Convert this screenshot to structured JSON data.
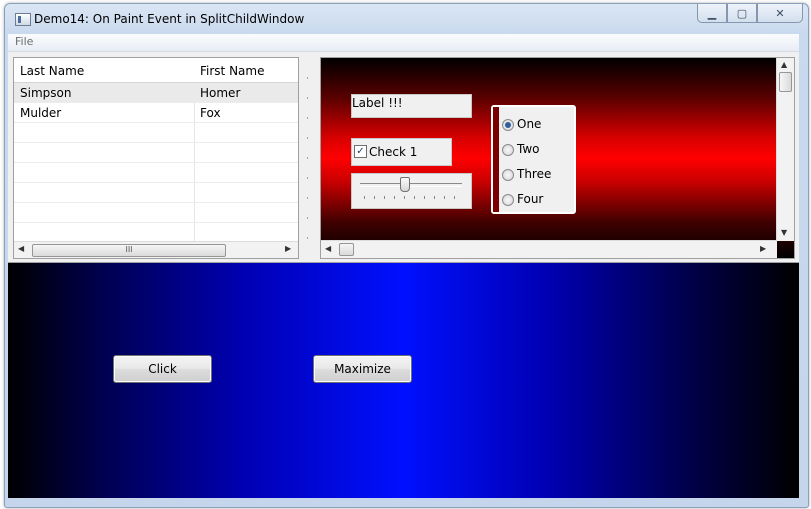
{
  "window": {
    "title": "Demo14: On Paint Event in SplitChildWindow",
    "caption_buttons": [
      "minimize-icon",
      "maximize-icon",
      "close-icon"
    ],
    "caption_glyphs": {
      "minimize": "▁",
      "maximize": "▢",
      "close": "✕"
    }
  },
  "menu": {
    "items": [
      {
        "label": "File"
      }
    ]
  },
  "table": {
    "columns": [
      "Last Name",
      "First Name"
    ],
    "rows": [
      {
        "last": "Simpson",
        "first": "Homer",
        "selected": true
      },
      {
        "last": "Mulder",
        "first": "Fox",
        "selected": false
      }
    ],
    "scroll_grip": "III",
    "arrows": {
      "left": "◀",
      "right": "▶"
    }
  },
  "red_panel": {
    "background": "#ff0000",
    "label": "Label !!!",
    "checkbox": {
      "label": "Check 1",
      "checked": true,
      "mark": "✓"
    },
    "slider": {
      "value": 0.45
    },
    "radios": [
      {
        "label": "One",
        "checked": true
      },
      {
        "label": "Two",
        "checked": false
      },
      {
        "label": "Three",
        "checked": false
      },
      {
        "label": "Four",
        "checked": false
      }
    ],
    "arrows": {
      "up": "▲",
      "down": "▼",
      "left": "◀",
      "right": "▶"
    }
  },
  "blue_panel": {
    "background": "#0010ff",
    "buttons": [
      {
        "label": "Click"
      },
      {
        "label": "Maximize"
      }
    ]
  }
}
